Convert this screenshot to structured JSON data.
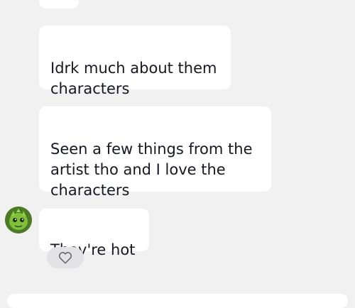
{
  "messages": [
    {
      "text": "Idrk much about them\ncharacters"
    },
    {
      "text": "Seen a few things from the\nartist tho and I love the\ncharacters"
    },
    {
      "text": "They're hot"
    }
  ],
  "sender": {
    "avatar_icon": "green-creature-avatar"
  },
  "reaction": {
    "icon": "heart-outline-icon"
  },
  "colors": {
    "background": "#f1f1f2",
    "bubble": "#ffffff",
    "text": "#161823",
    "avatar_green": "#5f9b2c"
  }
}
